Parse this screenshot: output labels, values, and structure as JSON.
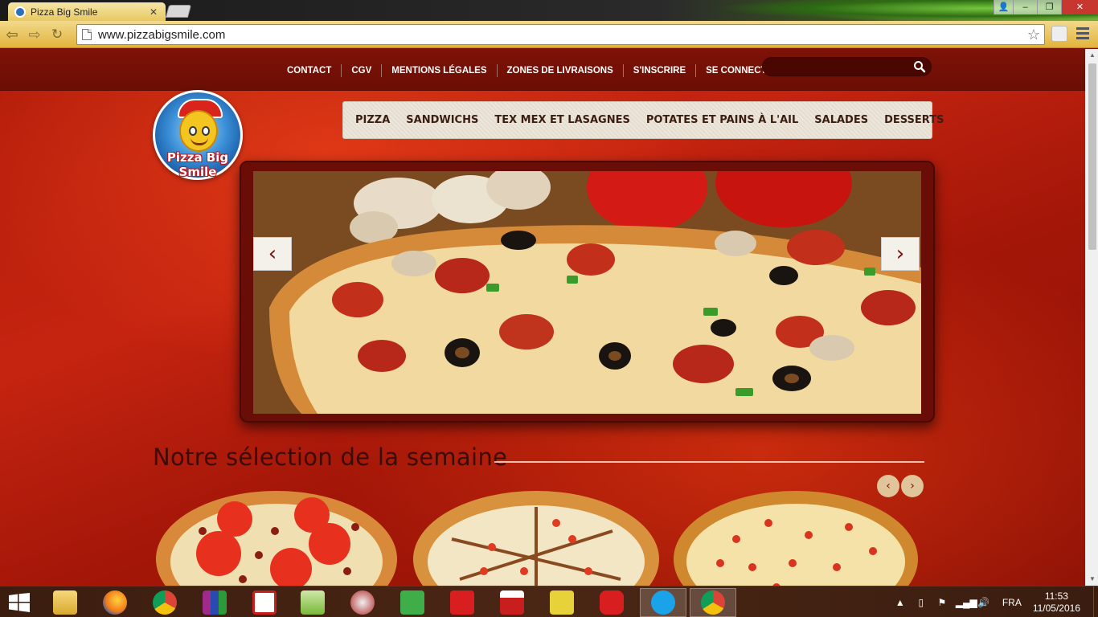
{
  "browser": {
    "tab_title": "Pizza Big Smile",
    "url": "www.pizzabigsmile.com"
  },
  "site": {
    "top_links": [
      "CONTACT",
      "CGV",
      "MENTIONS LÉGALES",
      "ZONES DE LIVRAISONS",
      "S'INSCRIRE",
      "SE CONNECTER"
    ],
    "search_placeholder": "",
    "logo_text": "Pizza Big Smile",
    "menu": [
      "PIZZA",
      "SANDWICHS",
      "TEX MEX ET LASAGNES",
      "POTATES ET PAINS À L'AIL",
      "SALADES",
      "DESSERTS"
    ],
    "slider_prev": "‹",
    "slider_next": "›",
    "section_title": "Notre sélection de la semaine",
    "carousel_prev": "‹",
    "carousel_next": "›"
  },
  "taskbar": {
    "apps": [
      "file-explorer",
      "firefox",
      "chrome",
      "winrar",
      "acrobat-reader",
      "notepad-plus",
      "snipping-tool",
      "qt-creator",
      "ic-app",
      "mplab-ide",
      "irfanview",
      "pic-app",
      "skype",
      "chrome-active"
    ],
    "language": "FRA",
    "time": "11:53",
    "date": "11/05/2016"
  },
  "colors": {
    "brand_red": "#b01b0a",
    "dark_red": "#6b0e05",
    "menu_bg": "#ece6db",
    "title_text": "#3b0c05"
  }
}
